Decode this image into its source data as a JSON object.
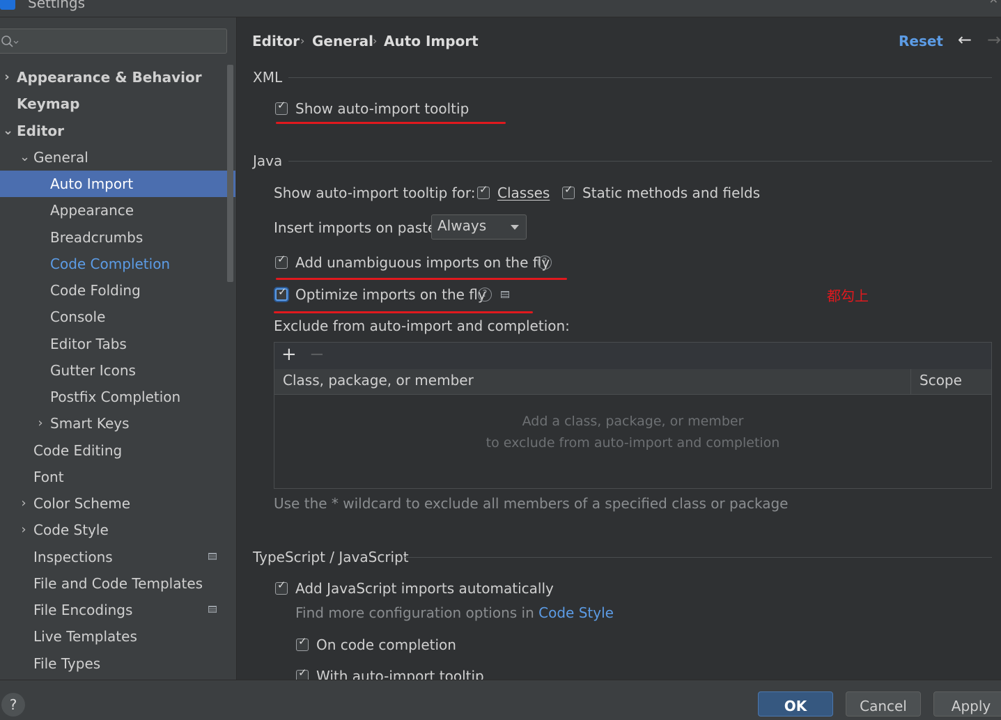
{
  "window": {
    "title": "Settings"
  },
  "sidebar": {
    "search": {
      "placeholder": ""
    },
    "tree": [
      {
        "label": "Appearance & Behavior",
        "expander": "›",
        "bold": true
      },
      {
        "label": "Keymap",
        "bold": true
      },
      {
        "label": "Editor",
        "expander": "⌄",
        "bold": true
      },
      {
        "label": "General",
        "expander": "⌄"
      },
      {
        "label": "Auto Import",
        "selected": true
      },
      {
        "label": "Appearance"
      },
      {
        "label": "Breadcrumbs"
      },
      {
        "label": "Code Completion",
        "highlighted": true
      },
      {
        "label": "Code Folding"
      },
      {
        "label": "Console"
      },
      {
        "label": "Editor Tabs"
      },
      {
        "label": "Gutter Icons"
      },
      {
        "label": "Postfix Completion"
      },
      {
        "label": "Smart Keys",
        "expander": "›"
      },
      {
        "label": "Code Editing"
      },
      {
        "label": "Font"
      },
      {
        "label": "Color Scheme",
        "expander": "›"
      },
      {
        "label": "Code Style",
        "expander": "›"
      },
      {
        "label": "Inspections",
        "badge": "project-icon"
      },
      {
        "label": "File and Code Templates"
      },
      {
        "label": "File Encodings",
        "badge": "project-icon"
      },
      {
        "label": "Live Templates"
      },
      {
        "label": "File Types"
      }
    ]
  },
  "header": {
    "breadcrumb": [
      "Editor",
      "General",
      "Auto Import"
    ],
    "breadcrumb_sep": "›",
    "reset_label": "Reset",
    "back_icon": "←",
    "forward_icon": "→"
  },
  "xml": {
    "section_title": "XML",
    "show_tooltip": {
      "label": "Show auto-import tooltip",
      "checked": true
    }
  },
  "java": {
    "section_title": "Java",
    "tooltip_for_label": "Show auto-import tooltip for:",
    "classes": {
      "label": "Classes",
      "checked": true
    },
    "static_members": {
      "label": "Static methods and fields",
      "checked": true
    },
    "insert_on_paste_label": "Insert imports on paste:",
    "insert_on_paste_value": "Always",
    "add_unambiguous": {
      "label": "Add unambiguous imports on the fly",
      "checked": true
    },
    "optimize_imports": {
      "label": "Optimize imports on the fly",
      "checked": true
    },
    "exclude_label": "Exclude from auto-import and completion:",
    "exclude_table": {
      "add_icon": "+",
      "remove_icon": "−",
      "columns": [
        "Class, package, or member",
        "Scope"
      ],
      "empty_line1": "Add a class, package, or member",
      "empty_line2": "to exclude from auto-import and completion"
    },
    "wildcard_hint": "Use the * wildcard to exclude all members of a specified class or package"
  },
  "typescript": {
    "section_title": "TypeScript / JavaScript",
    "add_js_imports": {
      "label": "Add JavaScript imports automatically",
      "checked": true
    },
    "more_config_prefix": "Find more configuration options in ",
    "more_config_link": "Code Style",
    "on_completion": {
      "label": "On code completion",
      "checked": true
    },
    "with_tooltip": {
      "label": "With auto-import tooltip",
      "checked": true
    }
  },
  "annotation": {
    "text": "都勾上",
    "color": "#e0191e"
  },
  "footer": {
    "help_icon": "?",
    "ok_label": "OK",
    "cancel_label": "Cancel",
    "apply_label": "Apply"
  },
  "colors": {
    "accent": "#5c9ce6",
    "selection": "#4b6eaf",
    "annotation_red": "#e0191e"
  }
}
